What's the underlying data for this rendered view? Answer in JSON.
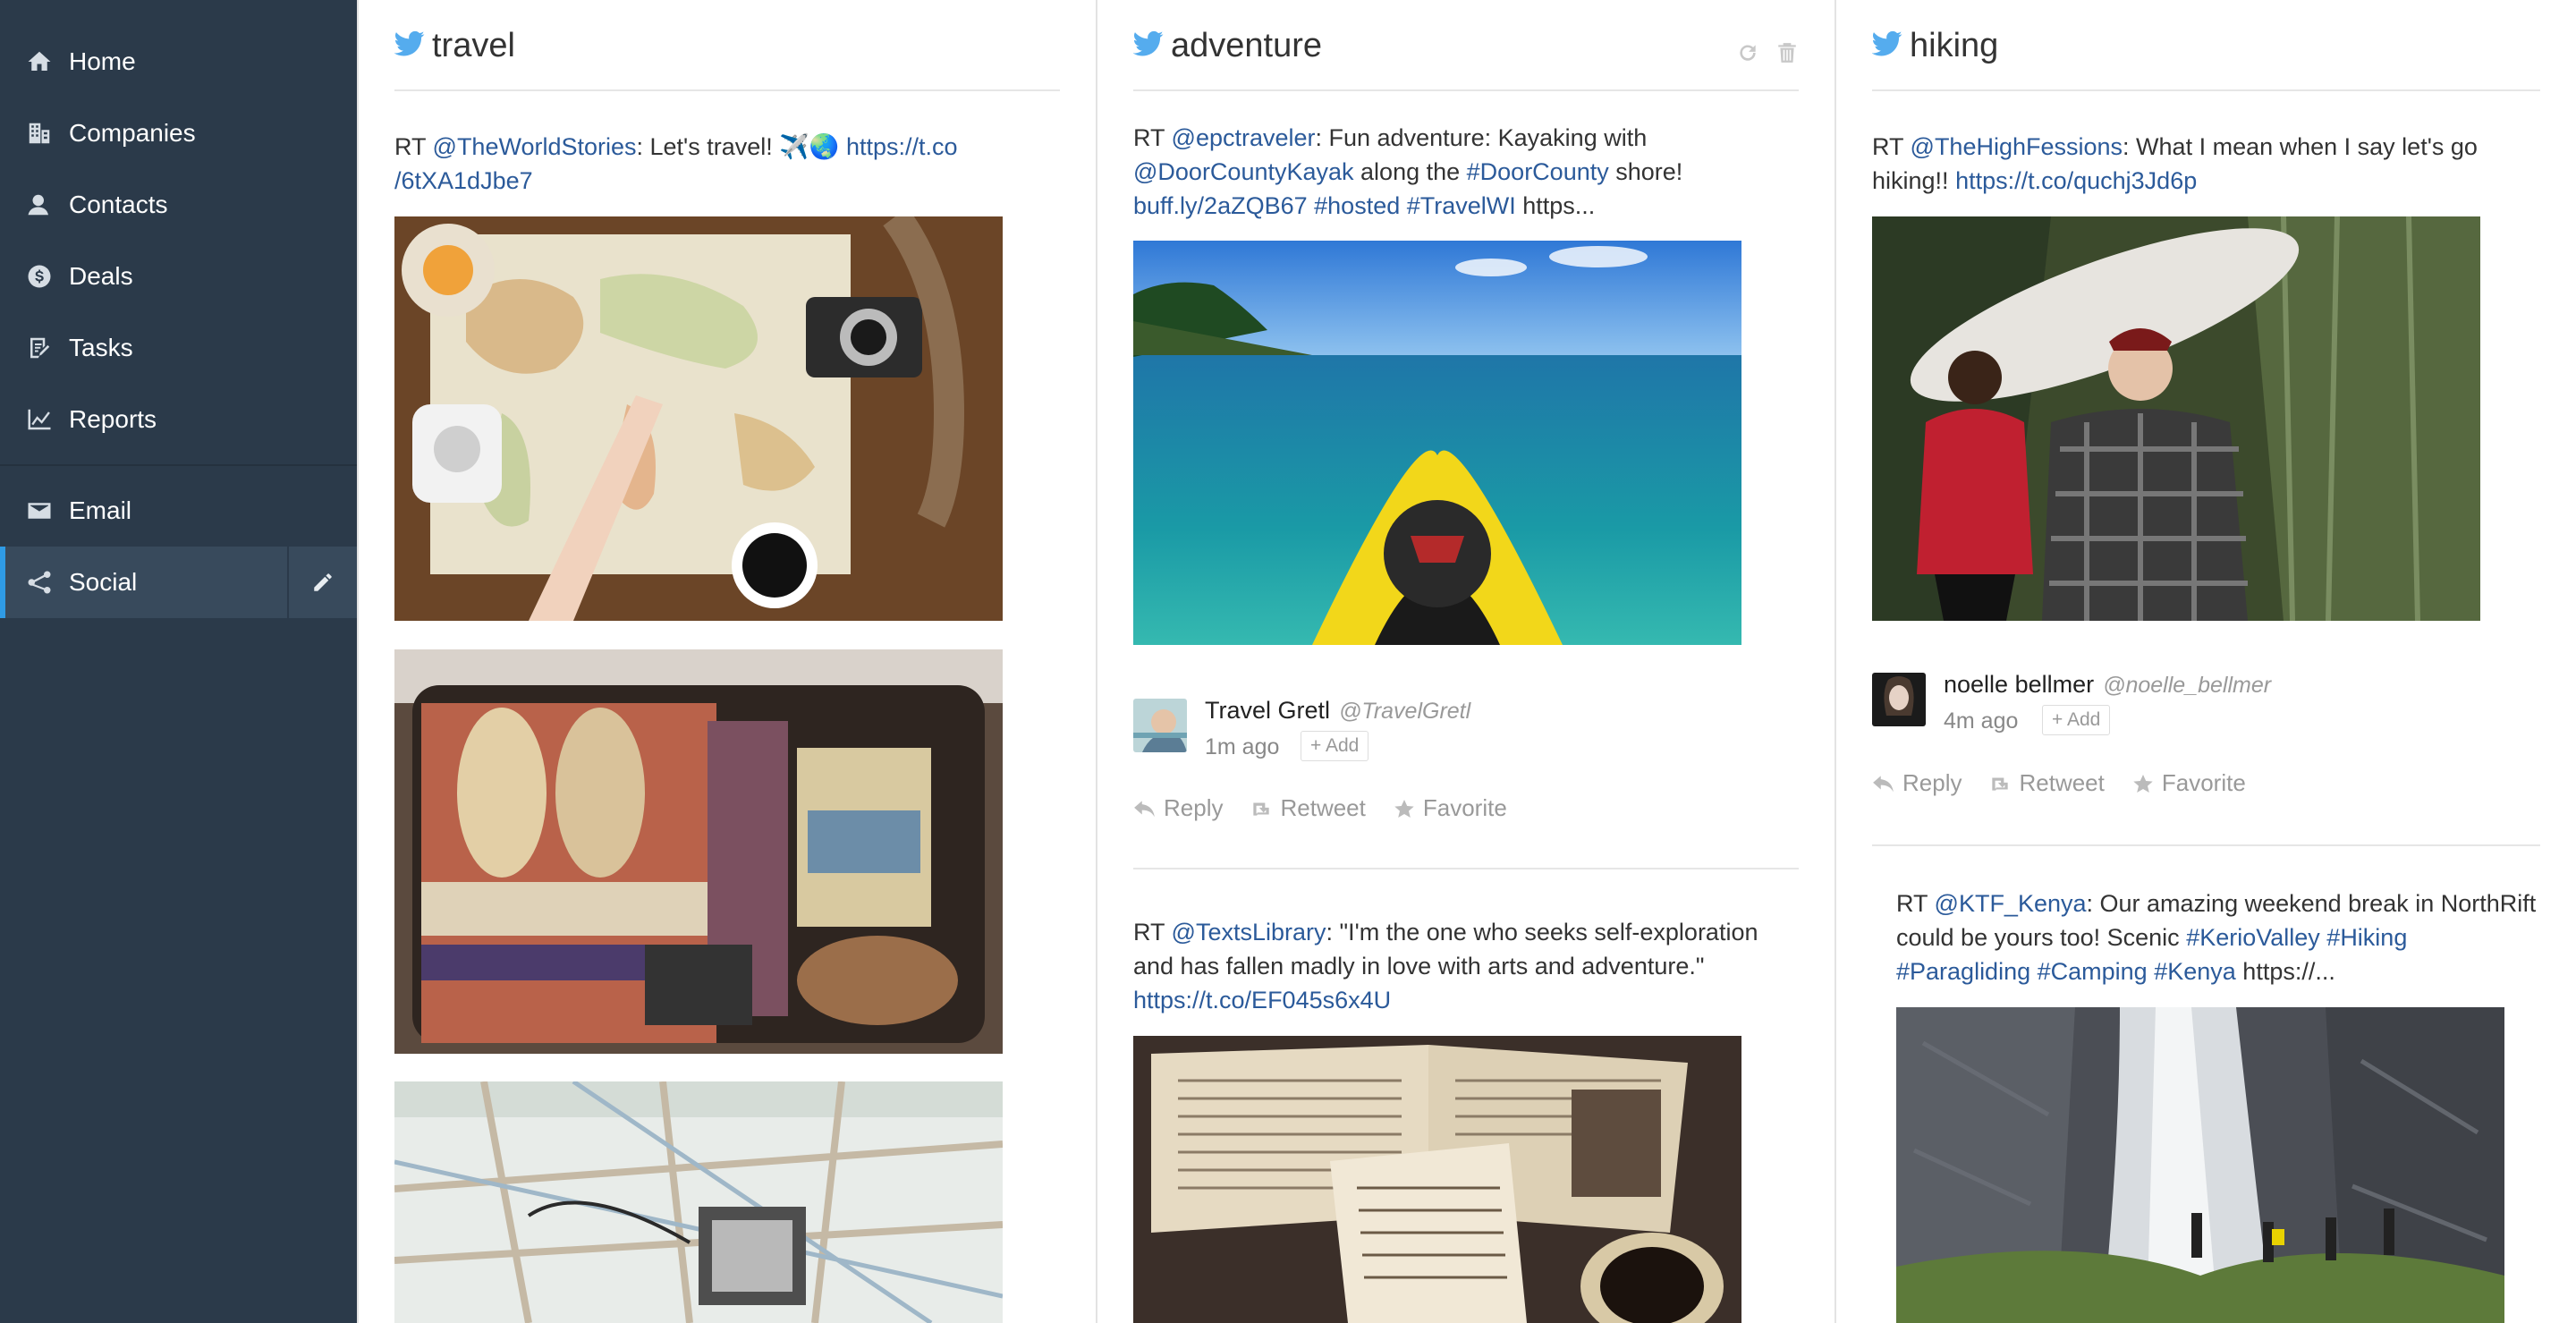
{
  "sidebar": {
    "items": [
      {
        "label": "Home",
        "icon": "home-icon"
      },
      {
        "label": "Companies",
        "icon": "building-icon"
      },
      {
        "label": "Contacts",
        "icon": "person-icon"
      },
      {
        "label": "Deals",
        "icon": "dollar-icon"
      },
      {
        "label": "Tasks",
        "icon": "checklist-icon"
      },
      {
        "label": "Reports",
        "icon": "chart-icon"
      },
      {
        "label": "Email",
        "icon": "envelope-icon"
      },
      {
        "label": "Social",
        "icon": "share-icon",
        "active": true
      }
    ],
    "active_color": "#2f9be5",
    "bg_color": "#2b3a4a"
  },
  "columns": [
    {
      "title": "travel",
      "tweets": [
        {
          "text_prefix": "RT ",
          "mention": "@TheWorldStories",
          "text_mid": ": Let's travel! ✈️🌏 ",
          "link_a": "https://t.co",
          "link_b": "/6tXA1dJbe7"
        }
      ]
    },
    {
      "title": "adventure",
      "tweets": [
        {
          "line1_prefix": "RT ",
          "line1_mention": "@epctraveler",
          "line1_text": ": Fun adventure: Kayaking with",
          "line2_mention": "@DoorCountyKayak",
          "line2_text": " along the ",
          "line2_hashtag": "#DoorCounty",
          "line2_end": " shore!",
          "line3_link": "buff.ly/2aZQB67",
          "line3_tag1": "#hosted",
          "line3_tag2": "#TravelWI",
          "line3_end": " https...",
          "author_name": "Travel Gretl",
          "author_handle": "@TravelGretl",
          "time": "1m ago",
          "add": "+ Add"
        },
        {
          "line1_prefix": "RT ",
          "line1_mention": "@TextsLibrary",
          "line1_text": ": \"I'm the one who seeks self-exploration",
          "line2_text": "and has fallen madly in love with arts and adventure.\"",
          "line3_link": "https://t.co/EF045s6x4U"
        }
      ],
      "actions": {
        "reply": "Reply",
        "retweet": "Retweet",
        "favorite": "Favorite"
      }
    },
    {
      "title": "hiking",
      "tweets": [
        {
          "line1_prefix": "RT ",
          "line1_mention": "@TheHighFessions",
          "line1_text": ": What I mean when I say let's go",
          "line2_text": "hiking!! ",
          "line2_link": "https://t.co/quchj3Jd6p",
          "author_name": "noelle bellmer",
          "author_handle": "@noelle_bellmer",
          "time": "4m ago",
          "add": "+ Add"
        },
        {
          "line1_prefix": "RT ",
          "line1_mention": "@KTF_Kenya",
          "line1_text": ": Our amazing weekend break in NorthRift",
          "line2_text": "could be yours too! Scenic ",
          "line2_tag1": "#KerioValley",
          "line2_tag2": "#Hiking",
          "line3_tag1": "#Paragliding",
          "line3_tag2": "#Camping",
          "line3_tag3": "#Kenya",
          "line3_end": " https://..."
        }
      ],
      "actions": {
        "reply": "Reply",
        "retweet": "Retweet",
        "favorite": "Favorite"
      }
    }
  ],
  "link_color": "#2b5a9a",
  "twitter_color": "#55acee"
}
